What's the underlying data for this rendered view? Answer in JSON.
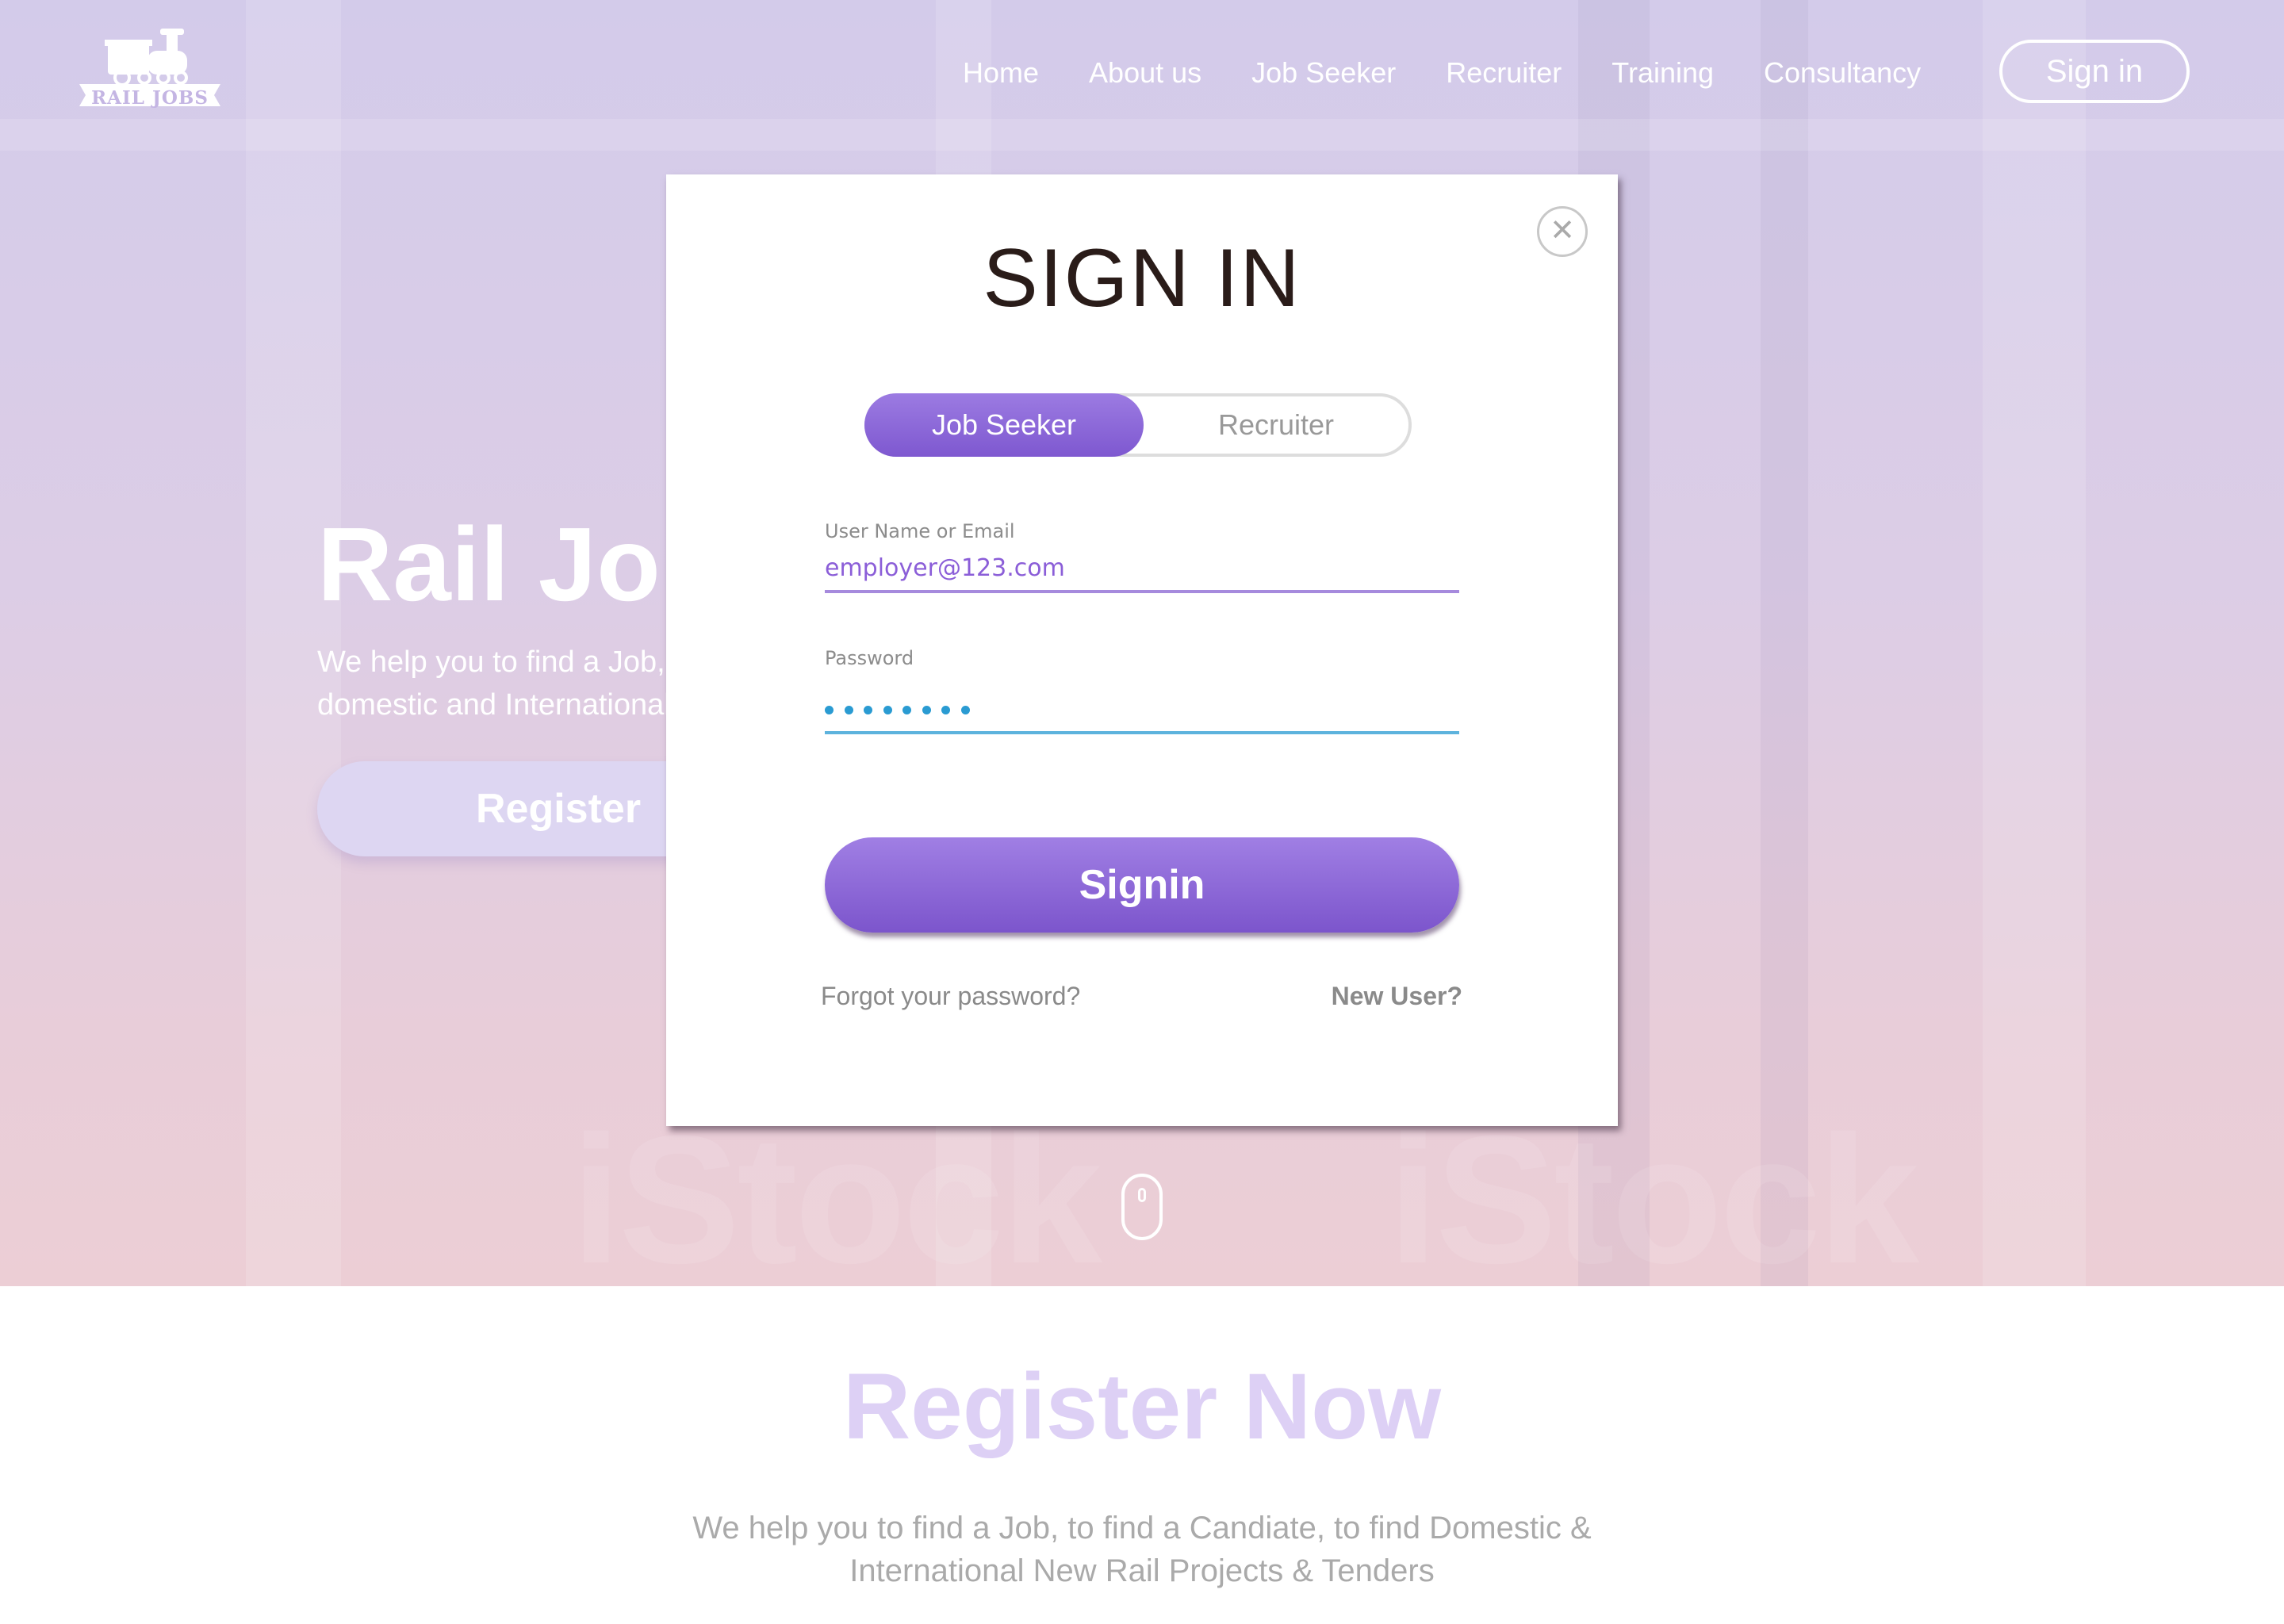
{
  "brand": {
    "logo_text": "RAIL JOBS"
  },
  "nav": {
    "items": [
      "Home",
      "About us",
      "Job Seeker",
      "Recruiter",
      "Training",
      "Consultancy"
    ],
    "signin_label": "Sign in"
  },
  "hero": {
    "title": "Rail Jobs",
    "subtitle": "We help you to find a Job, to find a Candiate, to find domestic and International New Rail Projects & Tenders",
    "register_label": "Register"
  },
  "register_section": {
    "title": "Register Now",
    "subtitle": "We help you to find a Job, to find a Candiate, to find Domestic & International New Rail Projects & Tenders"
  },
  "modal": {
    "title": "SIGN IN",
    "close_symbol": "✕",
    "tabs": {
      "active": "Job Seeker",
      "inactive": "Recruiter"
    },
    "username_label": "User Name or Email",
    "username_value": "employer@123.com",
    "password_label": "Password",
    "password_length": 8,
    "signin_label": "Signin",
    "forgot_label": "Forgot your password?",
    "new_user_label": "New User?"
  },
  "colors": {
    "accent": "#8b5ed8",
    "password_underline": "#5db3dd",
    "register_title": "#ddd0f5"
  },
  "icons": {
    "logo": "train-logo",
    "close": "close-icon",
    "scroll": "mouse-scroll-icon"
  }
}
